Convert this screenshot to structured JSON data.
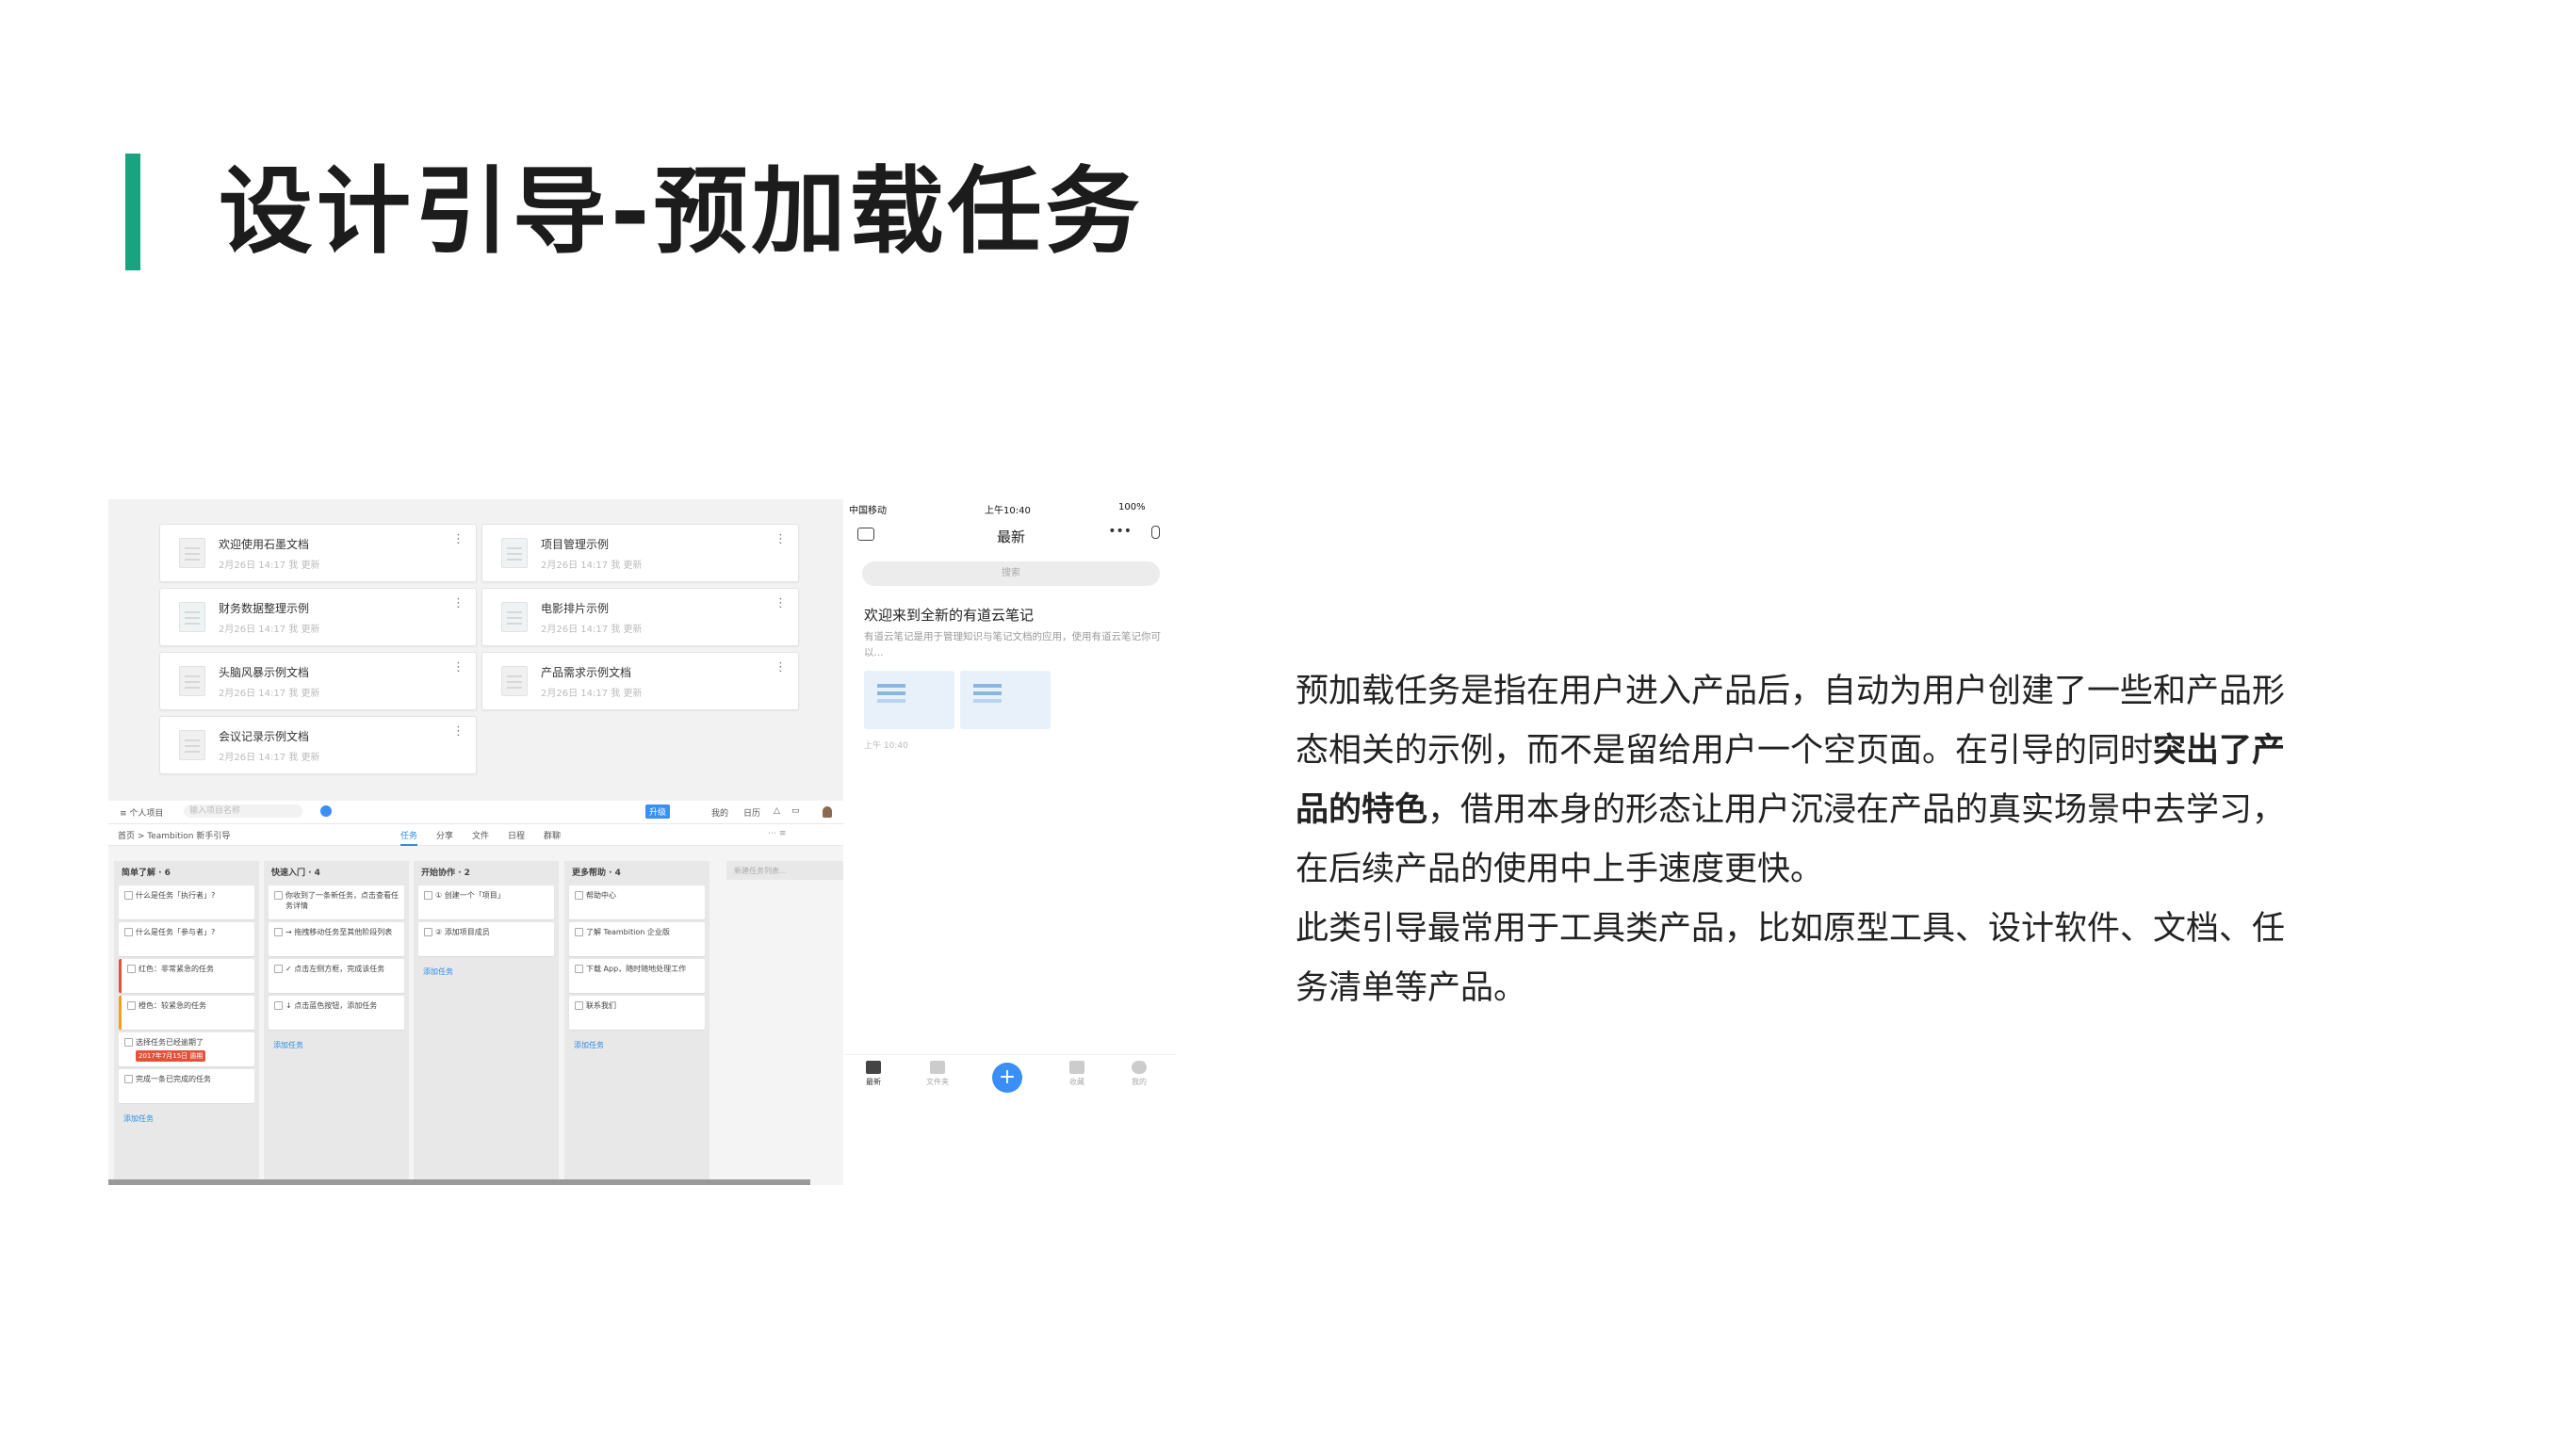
{
  "colors": {
    "accent": "#1aa281",
    "phone_primary": "#3a8ef6",
    "bookmark": "#3a8ef6"
  },
  "title": "设计引导-预加载任务",
  "body": {
    "p1_before": "预加载任务是指在用户进入产品后，自动为用户创建了一些和产品形态相关的示例，而不是留给用户一个空页面。在引导的同时",
    "p1_bold": "突出了产品的特色",
    "p1_after": "，借用本身的形态让用户沉浸在产品的真实场景中去学习，在后续产品的使用中上手速度更快。",
    "p2": "此类引导最常用于工具类产品，比如原型工具、设计软件、文档、任务清单等产品。"
  },
  "docs": {
    "meta": "2月26日 14:17 我 更新",
    "more_icon": "vertical-ellipsis",
    "items": [
      {
        "name": "欢迎使用石墨文档",
        "icon": "doc-icon"
      },
      {
        "name": "项目管理示例",
        "icon": "table-icon"
      },
      {
        "name": "财务数据整理示例",
        "icon": "table-icon"
      },
      {
        "name": "电影排片示例",
        "icon": "table-icon"
      },
      {
        "name": "头脑风暴示例文档",
        "icon": "doc-icon"
      },
      {
        "name": "产品需求示例文档",
        "icon": "doc-icon"
      },
      {
        "name": "会议记录示例文档",
        "icon": "doc-icon"
      }
    ]
  },
  "kanban": {
    "project_label": "个人项目",
    "search_placeholder": "输入项目名称",
    "upgrade_label": "升级",
    "nav_right": [
      "我的",
      "日历",
      "通知"
    ],
    "breadcrumb": "首页 > Teambition 新手引导",
    "tabs": [
      "任务",
      "分享",
      "文件",
      "日程",
      "群聊"
    ],
    "columns": [
      {
        "title": "简单了解 · 6",
        "cards": [
          {
            "text": "什么是任务「执行者」?",
            "style": ""
          },
          {
            "text": "什么是任务「参与者」?",
            "style": ""
          },
          {
            "text": "红色：非常紧急的任务",
            "style": "red"
          },
          {
            "text": "橙色：较紧急的任务",
            "style": "orange"
          },
          {
            "text": "选择任务已经逾期了",
            "style": "",
            "tag": "2017年7月15日 逾期"
          },
          {
            "text": "完成一条已完成的任务",
            "style": ""
          }
        ]
      },
      {
        "title": "快速入门 · 4",
        "cards": [
          {
            "text": "你收到了一条新任务，点击查看任务详情",
            "style": ""
          },
          {
            "text": "→ 拖拽移动任务至其他阶段列表",
            "style": ""
          },
          {
            "text": "✓ 点击左侧方框，完成该任务",
            "style": ""
          },
          {
            "text": "↓ 点击蓝色按钮，添加任务",
            "style": ""
          }
        ]
      },
      {
        "title": "开始协作 · 2",
        "cards": [
          {
            "text": "① 创建一个「项目」",
            "style": ""
          },
          {
            "text": "② 添加项目成员",
            "style": ""
          }
        ]
      },
      {
        "title": "更多帮助 · 4",
        "cards": [
          {
            "text": "帮助中心",
            "style": ""
          },
          {
            "text": "了解 Teambition 企业版",
            "style": ""
          },
          {
            "text": "下载 App，随时随地处理工作",
            "style": ""
          },
          {
            "text": "联系我们",
            "style": ""
          }
        ]
      }
    ],
    "add_task": "添加任务",
    "new_column": "新建任务列表..."
  },
  "phone": {
    "carrier": "中国移动",
    "time": "上午10:40",
    "battery": "100%",
    "title": "最新",
    "search_placeholder": "搜索",
    "note_title": "欢迎来到全新的有道云笔记",
    "note_desc": "有道云笔记是用于管理知识与笔记文档的应用，使用有道云笔记你可以...",
    "note_time": "上午 10:40",
    "tabs": [
      "最新",
      "文件夹",
      "",
      "收藏",
      "我的"
    ],
    "plus": "+"
  }
}
